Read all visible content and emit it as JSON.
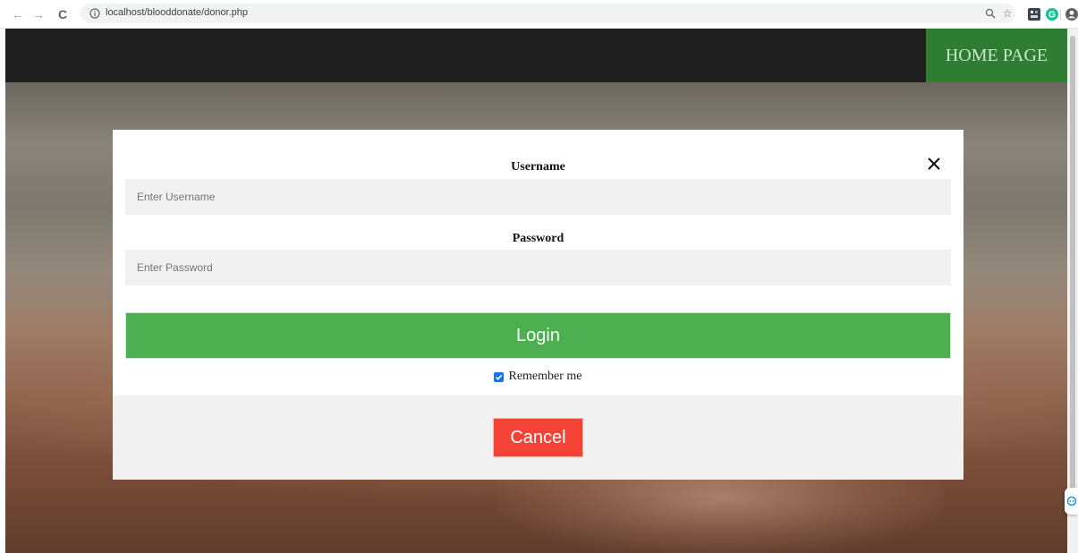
{
  "browser": {
    "url": "localhost/blooddonate/donor.php",
    "back_glyph": "←",
    "forward_glyph": "→",
    "reload_glyph": "C"
  },
  "nav": {
    "home_label": "HOME PAGE"
  },
  "modal": {
    "close_glyph": "✕",
    "username_label": "Username",
    "username_placeholder": "Enter Username",
    "password_label": "Password",
    "password_placeholder": "Enter Password",
    "login_label": "Login",
    "remember_label": "Remember me",
    "remember_checked": true,
    "cancel_label": "Cancel"
  },
  "colors": {
    "login": "#4caf50",
    "cancel": "#f44336",
    "home_bg": "#2e7d32",
    "nav_bg": "#1f1f1f"
  }
}
